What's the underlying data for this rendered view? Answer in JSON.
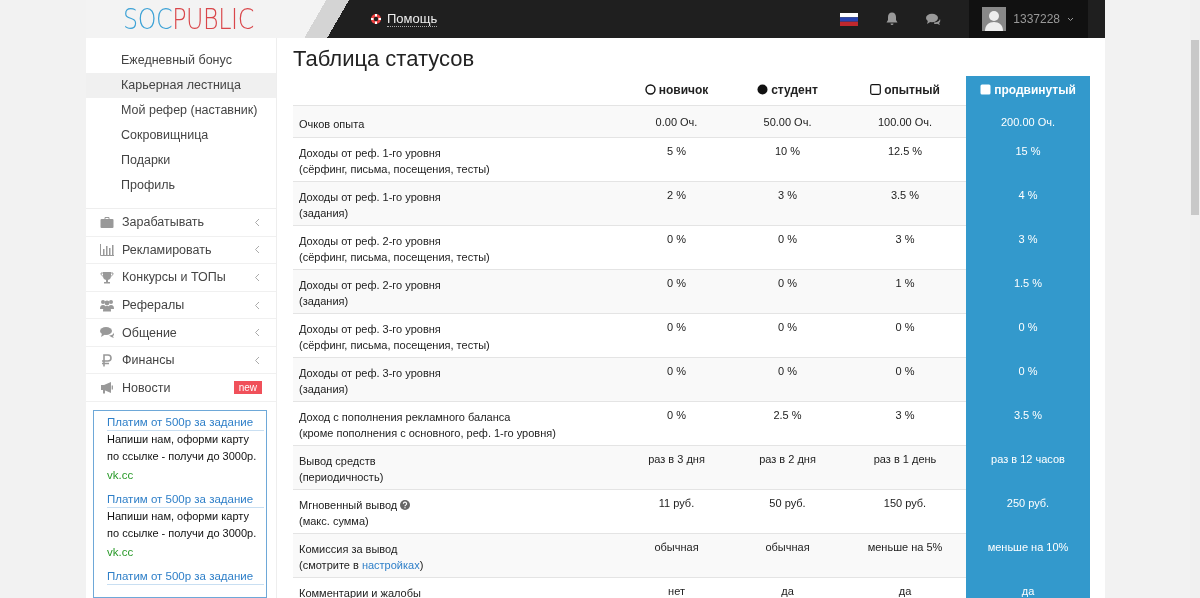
{
  "header": {
    "logo": {
      "first": "SOC",
      "second": "PUBLIC"
    },
    "help": "Помощь",
    "user": "1337228"
  },
  "sidebar": {
    "subitems": [
      {
        "label": "Ежедневный бонус",
        "selected": false
      },
      {
        "label": "Карьерная лестница",
        "selected": true
      },
      {
        "label": "Мой рефер (наставник)",
        "selected": false
      },
      {
        "label": "Сокровищница",
        "selected": false
      },
      {
        "label": "Подарки",
        "selected": false
      },
      {
        "label": "Профиль",
        "selected": false
      }
    ],
    "menu": [
      {
        "label": "Зарабатывать",
        "kind": "briefcase"
      },
      {
        "label": "Рекламировать",
        "kind": "chart"
      },
      {
        "label": "Конкурсы и ТОПы",
        "kind": "trophy"
      },
      {
        "label": "Рефералы",
        "kind": "users"
      },
      {
        "label": "Общение",
        "kind": "chat"
      },
      {
        "label": "Финансы",
        "kind": "ruble"
      },
      {
        "label": "Новости",
        "kind": "megaphone",
        "badge": "new"
      }
    ],
    "ads": [
      {
        "title": "Платим от 500р за задание",
        "text": "Напиши нам, оформи карту по ссылке - получи до 3000р.",
        "domain": "vk.cc"
      },
      {
        "title": "Платим от 500р за задание",
        "text": "Напиши нам, оформи карту по ссылке - получи до 3000р.",
        "domain": "vk.cc"
      },
      {
        "title": "Платим от 500р за задание"
      }
    ]
  },
  "title": "Таблица статусов",
  "table": {
    "columns": [
      {
        "label": "новичок",
        "kind": "circle-outline",
        "selected": false
      },
      {
        "label": "студент",
        "kind": "circle-filled",
        "selected": false
      },
      {
        "label": "опытный",
        "kind": "square-outline",
        "selected": false
      },
      {
        "label": "продвинутый",
        "kind": "square-filled",
        "selected": true
      }
    ],
    "rows": [
      {
        "label": "Очков опыта",
        "cells": [
          "0.00 Оч.",
          "50.00 Оч.",
          "100.00 Оч.",
          "200.00 Оч."
        ]
      },
      {
        "label": "Доходы от реф. 1-го уровня",
        "sub": [
          {
            "text": "(сёрфинг, письма, посещения, тесты)"
          }
        ],
        "cells": [
          "5 %",
          "10 %",
          "12.5 %",
          "15 %"
        ]
      },
      {
        "label": "Доходы от реф. 1-го уровня",
        "sub": [
          {
            "text": "(задания)"
          }
        ],
        "cells": [
          "2 %",
          "3 %",
          "3.5 %",
          "4 %"
        ]
      },
      {
        "label": "Доходы от реф. 2-го уровня",
        "sub": [
          {
            "text": "(сёрфинг, письма, посещения, тесты)"
          }
        ],
        "cells": [
          "0 %",
          "0 %",
          "3 %",
          "3 %"
        ]
      },
      {
        "label": "Доходы от реф. 2-го уровня",
        "sub": [
          {
            "text": "(задания)"
          }
        ],
        "cells": [
          "0 %",
          "0 %",
          "1 %",
          "1.5 %"
        ]
      },
      {
        "label": "Доходы от реф. 3-го уровня",
        "sub": [
          {
            "text": "(сёрфинг, письма, посещения, тесты)"
          }
        ],
        "cells": [
          "0 %",
          "0 %",
          "0 %",
          "0 %"
        ]
      },
      {
        "label": "Доходы от реф. 3-го уровня",
        "sub": [
          {
            "text": "(задания)"
          }
        ],
        "cells": [
          "0 %",
          "0 %",
          "0 %",
          "0 %"
        ]
      },
      {
        "label": "Доход с пополнения рекламного баланса",
        "sub": [
          {
            "text": "(кроме пополнения с основного, реф. 1-го уровня)"
          }
        ],
        "cells": [
          "0 %",
          "2.5 %",
          "3 %",
          "3.5 %"
        ]
      },
      {
        "label": "Вывод средств",
        "sub": [
          {
            "text": "(периодичность)"
          }
        ],
        "cells": [
          "раз в 3 дня",
          "раз в 2 дня",
          "раз в 1 день",
          "раз в 12 часов"
        ]
      },
      {
        "label": "Мгновенный вывод",
        "help": true,
        "sub": [
          {
            "text": "(макс. сумма)"
          }
        ],
        "cells": [
          "11 руб.",
          "50 руб.",
          "150 руб.",
          "250 руб."
        ]
      },
      {
        "label": "Комиссия за вывод",
        "sub": [
          {
            "text": "(смотрите в "
          },
          {
            "text": "настройках",
            "link": true
          },
          {
            "text": ")"
          }
        ],
        "cells": [
          "обычная",
          "обычная",
          "меньше на 5%",
          "меньше на 10%"
        ]
      },
      {
        "label": "Комментарии и жалобы",
        "cells": [
          "нет",
          "да",
          "да",
          "да"
        ]
      }
    ]
  }
}
